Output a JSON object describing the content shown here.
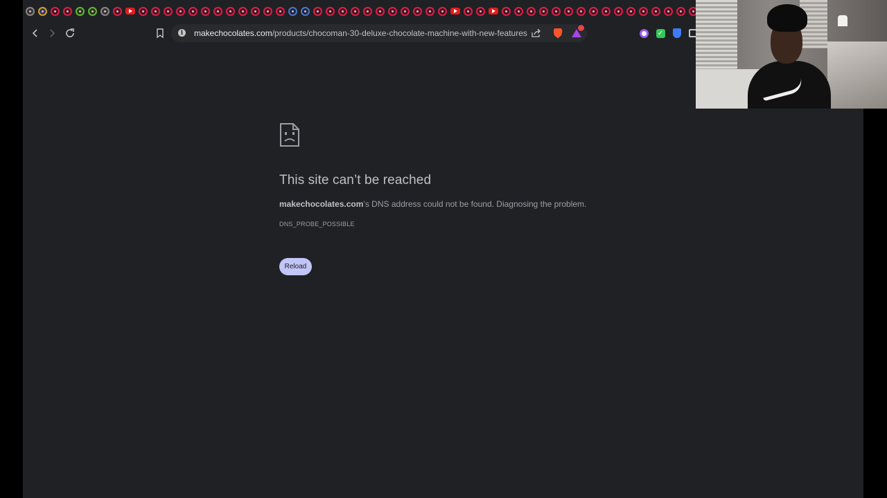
{
  "tabs": {
    "favicons": [
      "gray",
      "multi",
      "red",
      "red",
      "green",
      "green",
      "gray",
      "red",
      "yt",
      "red",
      "red",
      "red",
      "red",
      "red",
      "red",
      "red",
      "red",
      "red",
      "red",
      "red",
      "red",
      "blue",
      "blue",
      "red",
      "red",
      "red",
      "red",
      "red",
      "red",
      "red",
      "red",
      "red",
      "red",
      "red",
      "yt",
      "red",
      "red",
      "yt",
      "red",
      "red",
      "red",
      "red",
      "red",
      "red",
      "red",
      "red",
      "red",
      "red",
      "red",
      "red",
      "red",
      "red",
      "red",
      "red"
    ]
  },
  "toolbar": {
    "back_icon": "chevron-left",
    "forward_icon": "chevron-right",
    "reload_icon": "reload",
    "bookmark_icon": "bookmark",
    "url_domain": "makechocolates.com",
    "url_path": "/products/chocoman-30-deluxe-chocolate-machine-with-new-features",
    "share_icon": "share",
    "brave_shields_icon": "brave-lion",
    "brave_rewards_icon": "brave-rewards"
  },
  "error": {
    "title": "This site can’t be reached",
    "host": "makechocolates.com",
    "description_rest": "’s DNS address could not be found. Diagnosing the problem.",
    "code": "DNS_PROBE_POSSIBLE",
    "reload_label": "Reload"
  },
  "colors": {
    "page_bg": "#202124",
    "reload_button_bg": "#c2c5f7",
    "title_text": "#bdc1c6"
  }
}
